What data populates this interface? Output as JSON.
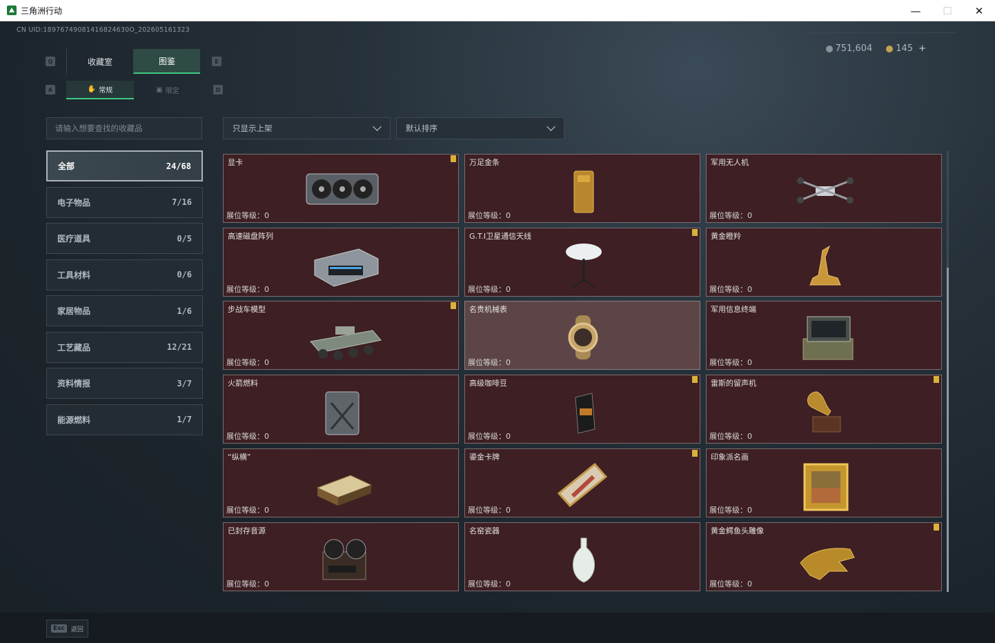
{
  "window": {
    "title": "三角洲行动",
    "minimize": "—",
    "maximize": "☐",
    "close": "✕"
  },
  "uid": "CN UID:18976749081416824630O_202605161323",
  "currency": {
    "silver": "751,604",
    "gold": "145",
    "add": "+"
  },
  "keyhints": {
    "q": "Q",
    "e": "E",
    "a": "A",
    "d": "D"
  },
  "tabs": [
    {
      "label": "收藏室"
    },
    {
      "label": "图鉴"
    }
  ],
  "subtabs": [
    {
      "label": "常规",
      "icon": "hand-icon"
    },
    {
      "label": "限定",
      "icon": "frame-icon"
    }
  ],
  "search": {
    "placeholder": "请输入想要查找的收藏品"
  },
  "filters": {
    "shelf": "只显示上架",
    "sort": "默认排序"
  },
  "categories": [
    {
      "label": "全部",
      "count": "24/68"
    },
    {
      "label": "电子物品",
      "count": "7/16"
    },
    {
      "label": "医疗道具",
      "count": "0/5"
    },
    {
      "label": "工具材料",
      "count": "0/6"
    },
    {
      "label": "家居物品",
      "count": "1/6"
    },
    {
      "label": "工艺藏品",
      "count": "12/21"
    },
    {
      "label": "资料情报",
      "count": "3/7"
    },
    {
      "label": "能源燃料",
      "count": "1/7"
    }
  ],
  "level_label": "展位等级：",
  "items": [
    {
      "name": "显卡",
      "level": "0",
      "flag": true,
      "art": "gpu"
    },
    {
      "name": "万足金条",
      "level": "0",
      "flag": false,
      "art": "goldbar"
    },
    {
      "name": "军用无人机",
      "level": "0",
      "flag": false,
      "art": "drone"
    },
    {
      "name": "高速磁盘阵列",
      "level": "0",
      "flag": false,
      "art": "disk"
    },
    {
      "name": "G.T.I卫星通信天线",
      "level": "0",
      "flag": true,
      "art": "antenna"
    },
    {
      "name": "黄金瞪羚",
      "level": "0",
      "flag": false,
      "art": "gazelle"
    },
    {
      "name": "步战车模型",
      "level": "0",
      "flag": true,
      "art": "ifv"
    },
    {
      "name": "名贵机械表",
      "level": "0",
      "flag": false,
      "art": "watch"
    },
    {
      "name": "军用信息终端",
      "level": "0",
      "flag": false,
      "art": "terminal"
    },
    {
      "name": "火箭燃料",
      "level": "0",
      "flag": false,
      "art": "fuel"
    },
    {
      "name": "高级咖啡豆",
      "level": "0",
      "flag": true,
      "art": "coffee"
    },
    {
      "name": "雷斯的留声机",
      "level": "0",
      "flag": true,
      "art": "gramophone"
    },
    {
      "name": "“纵横”",
      "level": "0",
      "flag": false,
      "art": "chess"
    },
    {
      "name": "鎏金卡牌",
      "level": "0",
      "flag": true,
      "art": "card"
    },
    {
      "name": "印象派名画",
      "level": "0",
      "flag": false,
      "art": "painting"
    },
    {
      "name": "已封存音源",
      "level": "0",
      "flag": false,
      "art": "reel"
    },
    {
      "name": "名窑瓷器",
      "level": "0",
      "flag": false,
      "art": "vase"
    },
    {
      "name": "黄金鳄鱼头雕像",
      "level": "0",
      "flag": true,
      "art": "croc"
    }
  ],
  "footer": {
    "key": "Esc",
    "label": "返回"
  },
  "colors": {
    "accent": "#3dcb85",
    "card_bg": "#3e1f23",
    "card_highlight": "#5d4547",
    "flag": "#d8b23a"
  }
}
